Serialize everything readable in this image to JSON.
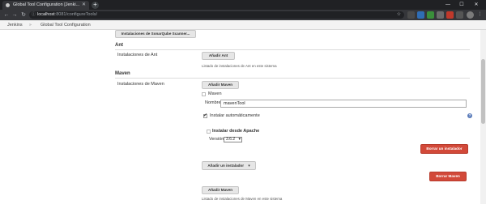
{
  "browser": {
    "tab_title": "Global Tool Configuration [Jenki...",
    "new_tab": "+",
    "url_host": "localhost",
    "url_path": ":8081/configureTools/",
    "window_controls": {
      "minimize": "—",
      "maximize": "☐",
      "close": "✕"
    },
    "nav": {
      "back": "←",
      "forward": "→",
      "reload": "↻"
    }
  },
  "breadcrumb": {
    "items": [
      "Jenkins",
      "Global Tool Configuration"
    ],
    "separator": "»"
  },
  "sonar": {
    "button_label": "Instalaciones de SonarQube Scanner..."
  },
  "ant": {
    "title": "Ant",
    "label": "Instalaciones de Ant",
    "add_button": "Añadir Ant",
    "description": "Listado de instalaciones de Ant en este sistema"
  },
  "maven": {
    "title": "Maven",
    "label": "Instalaciones de Maven",
    "add_button_top": "Añadir Maven",
    "group_label": "Maven",
    "name_label": "Nombre",
    "name_value": "mavenTool",
    "auto_install_label": "Instalar automáticamente",
    "install_from_label": "Instalar desde Apache",
    "version_label": "Versión",
    "version_value": "3.6.2",
    "delete_installer": "Borrar un instalador",
    "add_installer": "Añadir un instalador",
    "delete_maven": "Borrar Maven",
    "add_button_bottom": "Añadir Maven",
    "description": "Listado de instalaciones de Maven en este sistema"
  },
  "icons": {
    "help": "?",
    "lock": "ⓘ",
    "star": "☆",
    "dropdown": "▾"
  },
  "colors": {
    "danger": "#d24939",
    "help": "#5b7cba"
  }
}
